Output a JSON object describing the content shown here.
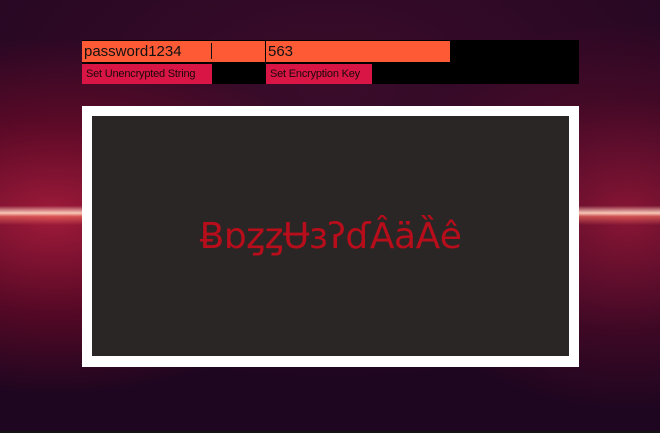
{
  "inputs": {
    "unencrypted_value": "password1234",
    "key_value": "563"
  },
  "buttons": {
    "set_unencrypted_label": "Set Unencrypted String",
    "set_key_label": "Set Encryption Key"
  },
  "output": {
    "encrypted_text": "ɃɒȥȥɄɜʔɗÂäȀê"
  },
  "colors": {
    "input_bg": "#ff5a36",
    "button_bg": "#d81545",
    "panel_bg": "#000000",
    "output_bg": "#2a2626",
    "output_text": "#b80d1a"
  }
}
